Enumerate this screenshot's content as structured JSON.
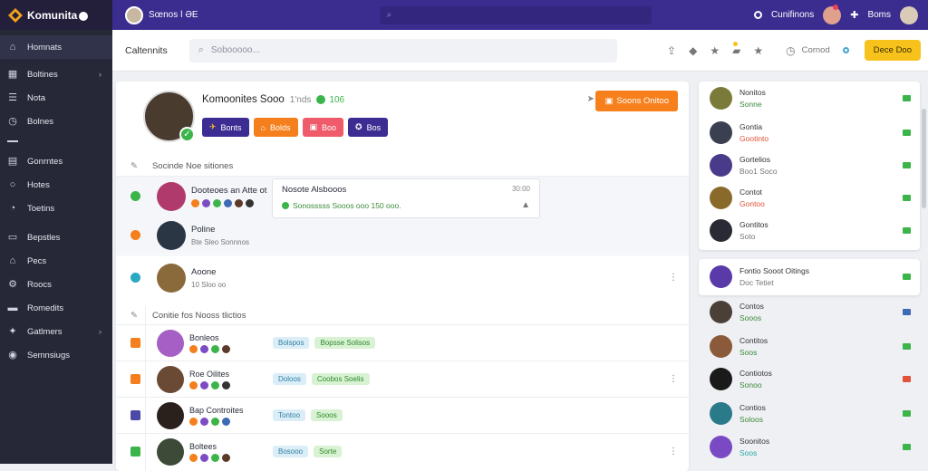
{
  "app": {
    "name": "Komunita"
  },
  "topbar": {
    "user_label": "Sœnos  ǀ  ƏE",
    "right_items": [
      "Cunifinons",
      "Boms"
    ]
  },
  "sidebar": {
    "items": [
      {
        "label": "Homnats",
        "icon": "home-icon",
        "active": true
      },
      {
        "label": "Boltines",
        "icon": "grid-icon",
        "chevron": true
      },
      {
        "label": "Nota",
        "icon": "list-icon"
      },
      {
        "label": "Bolnes",
        "icon": "clock-icon"
      },
      {
        "label": "",
        "icon": "divider-icon"
      },
      {
        "label": "Gonrntes",
        "icon": "document-icon"
      },
      {
        "label": "Hotes",
        "icon": "circle-icon"
      },
      {
        "label": "Toetins",
        "icon": "timer-icon"
      },
      {
        "label": "Bepstles",
        "icon": "briefcase-icon"
      },
      {
        "label": "Pecs",
        "icon": "home-icon"
      },
      {
        "label": "Roocs",
        "icon": "settings-icon"
      },
      {
        "label": "Romedits",
        "icon": "folder-icon"
      },
      {
        "label": "Gatlmers",
        "icon": "shirt-icon",
        "chevron": true
      },
      {
        "label": "Semnsiugs",
        "icon": "chat-icon"
      }
    ]
  },
  "header": {
    "title": "Caltennits",
    "search_placeholder": "Sobooooo...",
    "right_label": "Cornod",
    "action_label": "Dece Doo"
  },
  "profile": {
    "name": "Komoonites Sooo",
    "meta": "1'nds",
    "score": "106",
    "buttons": [
      {
        "label": "Bonts",
        "color": "#3d2d92",
        "icon": "ticket-icon"
      },
      {
        "label": "Bolds",
        "color": "#f47f1c",
        "icon": "gift-icon"
      },
      {
        "label": "Boo",
        "color": "#ef5b6b",
        "icon": "calendar-icon"
      },
      {
        "label": "Bos",
        "color": "#3d2d92",
        "icon": "medal-icon"
      }
    ],
    "action_label": "Soons Onitoo"
  },
  "section1": {
    "title": "Socinde Noe sitiones",
    "rows": [
      {
        "name": "Dooteoes an Atte ot",
        "sub": "",
        "bullet": "#3bb54a"
      },
      {
        "name": "Poline",
        "sub": "Bte   Sleo Sonnnos",
        "bullet": "#f47f1c"
      },
      {
        "name": "Aoone",
        "sub": "10   Sloo   oo",
        "bullet": "#2aa9c4"
      }
    ],
    "card": {
      "title": "Nosote Alsbooos",
      "time": "30:00",
      "details": "Sonosssss Sooos ooo 150  ooo."
    }
  },
  "section2": {
    "title": "Conitie fos Nooss tlictios",
    "rows": [
      {
        "name": "Bonleos",
        "tags": [
          "Bolspos",
          "Bopsse Solisos"
        ],
        "bullet": "#f47f1c"
      },
      {
        "name": "Roe Oilites",
        "tags": [
          "Doloos",
          "Coobos Soelis"
        ],
        "bullet": "#f47f1c"
      },
      {
        "name": "Bap Controites",
        "tags": [
          "Tontoo",
          "Sooos"
        ],
        "bullet": "#4c4aa8"
      },
      {
        "name": "Boltees",
        "tags": [
          "Bosooo",
          "Sorte"
        ],
        "bullet": "#3bb54a"
      }
    ]
  },
  "rightpanel": {
    "list1": [
      {
        "name": "Nonitos",
        "sub": "Sonne"
      },
      {
        "name": "Gontia",
        "sub": "Gootinto"
      },
      {
        "name": "Gortelios",
        "sub": "Boo1 Soco"
      },
      {
        "name": "Contot",
        "sub": "Gontoo"
      },
      {
        "name": "Gontitos",
        "sub": "Soto"
      }
    ],
    "featured": {
      "name": "Fontio Sooot Oitings",
      "sub": "Doc Tetiet"
    },
    "list2": [
      {
        "name": "Contos",
        "sub": "Sooos"
      },
      {
        "name": "Contitos",
        "sub": "Soos"
      },
      {
        "name": "Contiotos",
        "sub": "Sonoo"
      },
      {
        "name": "Contios",
        "sub": "Soloos"
      },
      {
        "name": "Soonitos",
        "sub": "Soos"
      }
    ]
  }
}
